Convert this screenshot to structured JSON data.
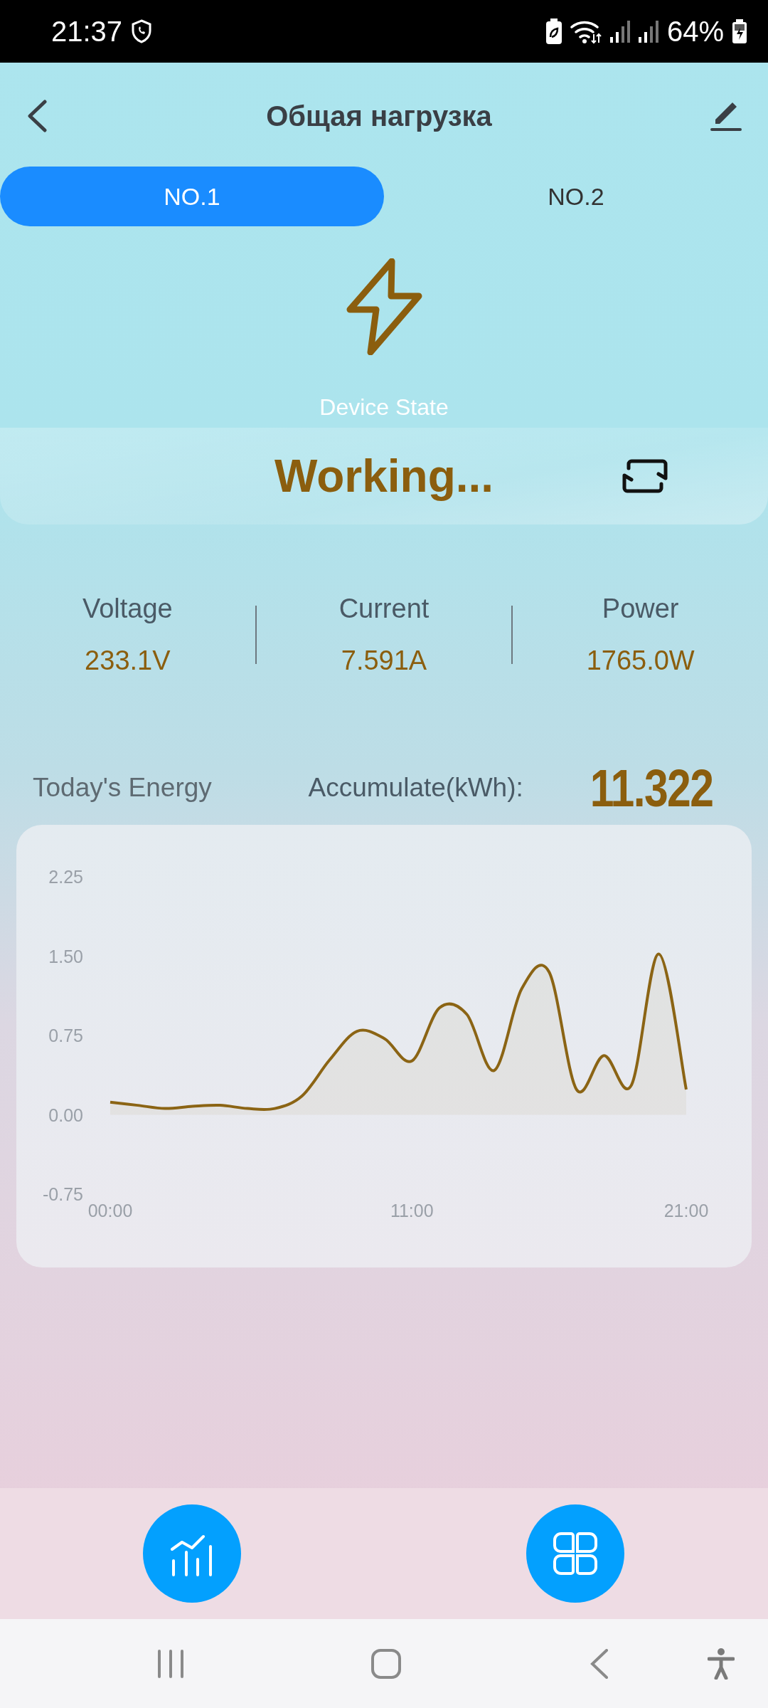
{
  "status_bar": {
    "time": "21:37",
    "battery": "64%"
  },
  "header": {
    "title": "Общая нагрузка"
  },
  "tabs": [
    {
      "label": "NO.1",
      "selected": true
    },
    {
      "label": "NO.2",
      "selected": false
    }
  ],
  "device": {
    "label": "Device State",
    "state": "Working..."
  },
  "metrics": [
    {
      "label": "Voltage",
      "value": "233.1V"
    },
    {
      "label": "Current",
      "value": "7.591A"
    },
    {
      "label": "Power",
      "value": "1765.0W"
    }
  ],
  "energy": {
    "title": "Today's Energy",
    "accumulate_label": "Accumulate(kWh):",
    "accumulate_value": "11.322",
    "chart_data": {
      "type": "area",
      "x": [
        0,
        1,
        2,
        3,
        4,
        5,
        6,
        7,
        8,
        9,
        10,
        11,
        12,
        13,
        14,
        15,
        16,
        17,
        18,
        19,
        20,
        21
      ],
      "xlim": [
        0,
        21
      ],
      "ylim": [
        -0.75,
        2.25
      ],
      "xticks": [
        {
          "value": 0,
          "label": "00:00"
        },
        {
          "value": 11,
          "label": "11:00"
        },
        {
          "value": 21,
          "label": "21:00"
        }
      ],
      "yticks": [
        {
          "value": -0.75,
          "label": "-0.75"
        },
        {
          "value": 0,
          "label": "0.00"
        },
        {
          "value": 0.75,
          "label": "0.75"
        },
        {
          "value": 1.5,
          "label": "1.50"
        },
        {
          "value": 2.25,
          "label": "2.25"
        }
      ],
      "series": [
        {
          "color": "#8b6414",
          "values": [
            0.12,
            0.09,
            0.06,
            0.08,
            0.09,
            0.06,
            0.06,
            0.18,
            0.52,
            0.79,
            0.72,
            0.51,
            1.01,
            0.95,
            0.42,
            1.19,
            1.35,
            0.24,
            0.56,
            0.28,
            1.52,
            0.24
          ]
        }
      ]
    }
  }
}
